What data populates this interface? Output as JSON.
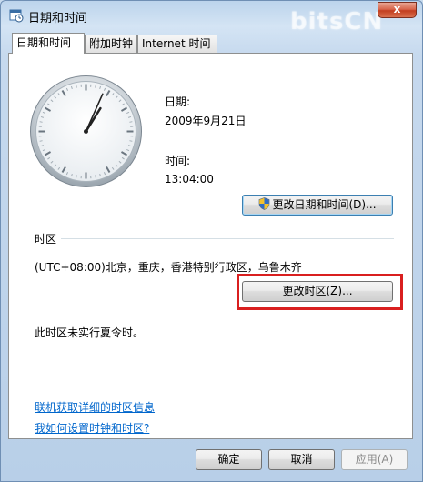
{
  "window": {
    "title": "日期和时间",
    "close_label": "x",
    "watermark": "bitsCN"
  },
  "tabs": [
    {
      "label": "日期和时间"
    },
    {
      "label": "附加时钟"
    },
    {
      "label": "Internet 时间"
    }
  ],
  "date": {
    "label": "日期:",
    "value": "2009年9月21日"
  },
  "time": {
    "label": "时间:",
    "value": "13:04:00"
  },
  "change_datetime_button": "更改日期和时间(D)...",
  "timezone": {
    "section_label": "时区",
    "value": "(UTC+08:00)北京，重庆，香港特别行政区，乌鲁木齐",
    "change_button": "更改时区(Z)...",
    "dst_note": "此时区未实行夏令时。"
  },
  "links": {
    "online_info": "联机获取详细的时区信息",
    "how_to": "我如何设置时钟和时区?"
  },
  "footer": {
    "ok": "确定",
    "cancel": "取消",
    "apply": "应用(A)"
  },
  "clock": {
    "hour": 13,
    "minute": 4,
    "second": 0
  },
  "colors": {
    "highlight": "#d91f1f",
    "link": "#0066cc"
  }
}
